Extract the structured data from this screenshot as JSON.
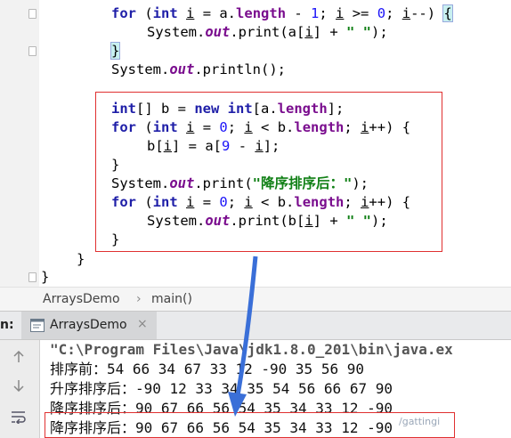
{
  "editor": {
    "lines": [
      {
        "segments": [
          [
            "kw",
            "for"
          ],
          [
            "",
            "("
          ],
          [
            "kw",
            "int"
          ],
          [
            "",
            ""
          ],
          [
            "u",
            "i"
          ],
          [
            "",
            ""
          ]
        ],
        "text_id": 0
      },
      {}
    ],
    "line1": {
      "kw_for": "for",
      "p1": " (",
      "kw_int": "int",
      "sp": " ",
      "var_i": "i",
      "mid": " = a.",
      "fld": "length",
      "rest": " - ",
      "n1": "1",
      "semi": "; ",
      "i2": "i",
      "ge": " >= ",
      "n0": "0",
      "semi2": "; ",
      "i3": "i",
      "dec": "--) ",
      "brace": "{"
    },
    "line2": {
      "a": "System.",
      "out": "out",
      "b": ".print(a[",
      "i": "i",
      "c": "] + ",
      "s": "\" \"",
      "d": ");"
    },
    "line3": {
      "brace": "}"
    },
    "line4": {
      "a": "System.",
      "out": "out",
      "b": ".println();"
    },
    "line5": {
      "kw": "int",
      "a": "[] b = ",
      "new": "new",
      "sp": " ",
      "kw2": "int",
      "b": "[a.",
      "fld": "length",
      "c": "];"
    },
    "line6": {
      "kw_for": "for",
      "p1": " (",
      "kw_int": "int",
      "sp": " ",
      "i": "i",
      "mid": " = ",
      "n0": "0",
      "semi": "; ",
      "i2": "i",
      "lt": " < b.",
      "fld": "length",
      "semi2": "; ",
      "i3": "i",
      "inc": "++) {"
    },
    "line7": {
      "a": "b[",
      "i": "i",
      "b": "] = a[",
      "n9": "9",
      "c": " - ",
      "i2": "i",
      "d": "];"
    },
    "line8": {
      "brace": "}"
    },
    "line9": {
      "a": "System.",
      "out": "out",
      "b": ".print(",
      "s": "\"降序排序后：\"",
      "d": ");"
    },
    "line10": {
      "kw_for": "for",
      "p1": " (",
      "kw_int": "int",
      "sp": " ",
      "i": "i",
      "mid": " = ",
      "n0": "0",
      "semi": "; ",
      "i2": "i",
      "lt": " < b.",
      "fld": "length",
      "semi2": "; ",
      "i3": "i",
      "inc": "++) {"
    },
    "line11": {
      "a": "System.",
      "out": "out",
      "b": ".print(b[",
      "i": "i",
      "c": "] + ",
      "s": "\" \"",
      "d": ");"
    },
    "line12": {
      "brace": "}"
    },
    "line13": {
      "brace": "}"
    },
    "line14": {
      "brace": "}"
    }
  },
  "breadcrumb": {
    "class_name": "ArraysDemo",
    "separator": "›",
    "method": "main()"
  },
  "run": {
    "prefix": "n:",
    "tab_label": "ArraysDemo",
    "close": "×",
    "tab_icon": "console-icon",
    "console_lines": [
      "\"C:\\Program Files\\Java\\jdk1.8.0_201\\bin\\java.ex",
      "排序前：54 66 34 67 33 12 -90 35 56 90",
      "升序排序后：-90 12 33 34 35 54 56 66 67 90",
      "降序排序后：90 67 66 56 54 35 34 33 12 -90",
      "降序排序后：90 67 66 56 54 35 34 33 12 -90"
    ]
  },
  "watermark": "/gattingi",
  "colors": {
    "keyword": "#1f1fa8",
    "number": "#1c14f8",
    "string": "#118016",
    "field": "#7a0d8e",
    "highlight_box": "#e03030",
    "arrow": "#3a6fd8"
  }
}
